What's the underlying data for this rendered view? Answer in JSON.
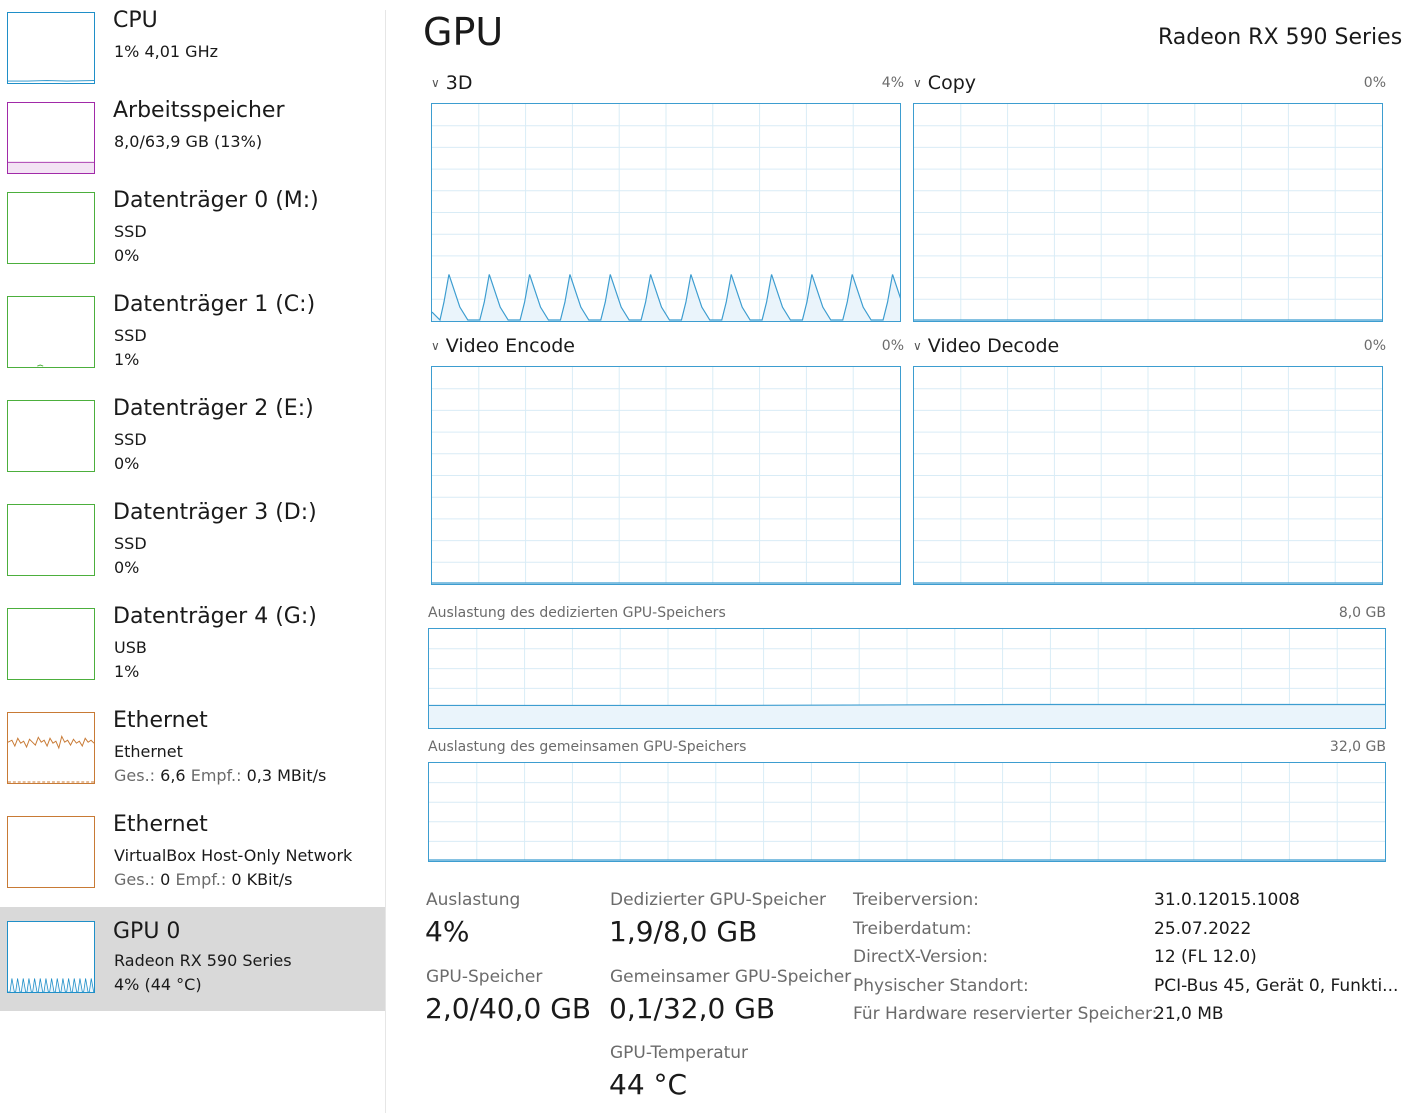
{
  "sidebar": {
    "items": [
      {
        "title": "CPU",
        "line1": "1%  4,01 GHz",
        "color": "#1f8fc8"
      },
      {
        "title": "Arbeitsspeicher",
        "line1": "8,0/63,9 GB (13%)",
        "color": "#a12aa8"
      },
      {
        "title": "Datenträger 0 (M:)",
        "line1": "SSD",
        "line2": "0%",
        "color": "#4caf3d"
      },
      {
        "title": "Datenträger 1 (C:)",
        "line1": "SSD",
        "line2": "1%",
        "color": "#4caf3d"
      },
      {
        "title": "Datenträger 2 (E:)",
        "line1": "SSD",
        "line2": "0%",
        "color": "#4caf3d"
      },
      {
        "title": "Datenträger 3 (D:)",
        "line1": "SSD",
        "line2": "0%",
        "color": "#4caf3d"
      },
      {
        "title": "Datenträger 4 (G:)",
        "line1": "USB",
        "line2": "1%",
        "color": "#4caf3d"
      },
      {
        "title": "Ethernet",
        "line1": "Ethernet",
        "send_label": "Ges.:",
        "send_value": "6,6",
        "recv_label": "Empf.:",
        "recv_value": "0,3 MBit/s",
        "color": "#c87a35"
      },
      {
        "title": "Ethernet",
        "line1": "VirtualBox Host-Only Network",
        "send_label": "Ges.:",
        "send_value": "0",
        "recv_label": "Empf.:",
        "recv_value": "0 KBit/s",
        "color": "#c87a35"
      },
      {
        "title": "GPU 0",
        "line1": "Radeon RX 590 Series",
        "line2": "4% (44 °C)",
        "color": "#1f8fc8"
      }
    ]
  },
  "main": {
    "title": "GPU",
    "model": "Radeon RX 590 Series",
    "engines": [
      {
        "label": "3D",
        "percent": "4%"
      },
      {
        "label": "Copy",
        "percent": "0%"
      },
      {
        "label": "Video Encode",
        "percent": "0%"
      },
      {
        "label": "Video Decode",
        "percent": "0%"
      }
    ],
    "dedicated_memory": {
      "label": "Auslastung des dedizierten GPU-Speichers",
      "max": "8,0 GB"
    },
    "shared_memory": {
      "label": "Auslastung des gemeinsamen GPU-Speichers",
      "max": "32,0 GB"
    },
    "stats": {
      "utilization": {
        "label": "Auslastung",
        "value": "4%"
      },
      "dedicated": {
        "label": "Dedizierter GPU-Speicher",
        "value": "1,9/8,0 GB"
      },
      "gpu_memory": {
        "label": "GPU-Speicher",
        "value": "2,0/40,0 GB"
      },
      "shared": {
        "label": "Gemeinsamer GPU-Speicher",
        "value": "0,1/32,0 GB"
      },
      "temperature": {
        "label": "GPU-Temperatur",
        "value": "44 °C"
      }
    },
    "info": [
      {
        "label": "Treiberversion:",
        "value": "31.0.12015.1008"
      },
      {
        "label": "Treiberdatum:",
        "value": "25.07.2022"
      },
      {
        "label": "DirectX-Version:",
        "value": "12 (FL 12.0)"
      },
      {
        "label": "Physischer Standort:",
        "value": "PCI-Bus 45, Gerät 0, Funkti..."
      },
      {
        "label": "Für Hardware reservierter Speicher:",
        "value": "21,0 MB"
      }
    ]
  },
  "colors": {
    "gpu_chart": "#3d9dd0",
    "grid": "#d9ecf6",
    "selected_bg": "#d9d9d9"
  }
}
